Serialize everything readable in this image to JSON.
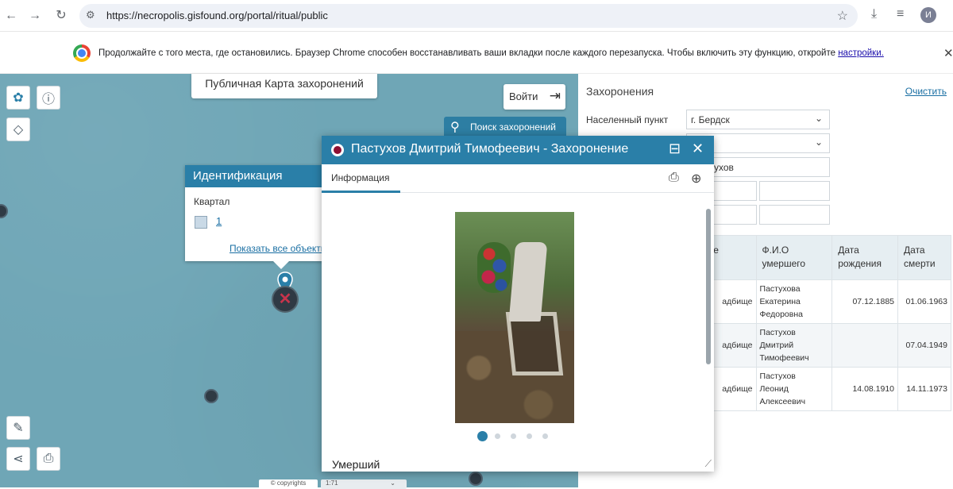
{
  "browser": {
    "url": "https://necropolis.gisfound.org/portal/ritual/public",
    "profile_initial": "И",
    "infobar_text": "Продолжайте с того места, где остановились. Браузер Chrome способен восстанавливать ваши вкладки после каждого перезапуска. Чтобы включить эту функцию, откройте",
    "infobar_link": "настройки."
  },
  "map": {
    "title": "Публичная Карта захоронений",
    "login_label": "Войти",
    "search_label": "Поиск захоронений",
    "copyright": "© copyrights",
    "scale": "1:71",
    "identify": {
      "title": "Идентификация",
      "layer_label": "Квартал",
      "item": "1",
      "show_all": "Показать все объекты"
    }
  },
  "panel": {
    "title": "Захоронения",
    "clear_label": "Очистить",
    "settlement_label": "Населенный пункт",
    "settlement_value": "г. Бердск",
    "name_value": "ухов",
    "columns": [
      "вание\nа",
      "Ф.И.О\nумершего",
      "Дата\nрождения",
      "Дата\nсмерти"
    ],
    "rows": [
      {
        "cemetery": "адбище",
        "name": "Пастухова\nЕкатерина\nФедоровна",
        "birth": "07.12.1885",
        "death": "01.06.1963"
      },
      {
        "cemetery": "адбище",
        "name": "Пастухов\nДмитрий\nТимофеевич",
        "birth": "",
        "death": "07.04.1949"
      },
      {
        "cemetery": "адбище",
        "name": "Пастухов\nЛеонид\nАлексеевич",
        "birth": "14.08.1910",
        "death": "14.11.1973"
      }
    ]
  },
  "dialog": {
    "title": "Пастухов Дмитрий Тимофеевич - Захоронение",
    "tab_info": "Информация",
    "section_label": "Умерший",
    "photo_count": 5,
    "photo_index": 1
  },
  "colors": {
    "accent": "#2a7fa8",
    "map_bg": "#6fa6b6",
    "marker": "#c8344c"
  }
}
